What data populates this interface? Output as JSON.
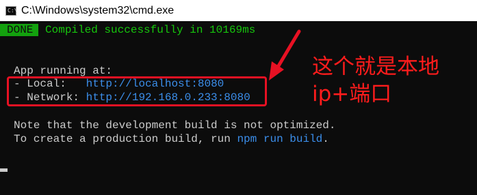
{
  "window": {
    "title": "C:\\Windows\\system32\\cmd.exe",
    "icon": "cmd-icon"
  },
  "console": {
    "done_badge": "DONE",
    "compile_message": "Compiled successfully in 10169ms",
    "app_running": "App running at:",
    "local_label": "- Local:   ",
    "local_url": "http://localhost:",
    "local_port": "8080",
    "network_label": "- Network: ",
    "network_url": "http://192.168.0.233:",
    "network_port": "8080",
    "note_line1": "Note that the development build is not optimized.",
    "note_line2_prefix": "To create a production build, run ",
    "note_command": "npm run build",
    "note_line2_suffix": "."
  },
  "annotation": {
    "line1": "这个就是本地",
    "line2": "ip+端口",
    "color": "#ff1c1c"
  },
  "colors": {
    "console_bg": "#0c0c0c",
    "console_text": "#cccccc",
    "success_green": "#16c60c",
    "badge_green": "#13a10e",
    "url_blue": "#3b8eea",
    "highlight_red": "#e81123"
  }
}
